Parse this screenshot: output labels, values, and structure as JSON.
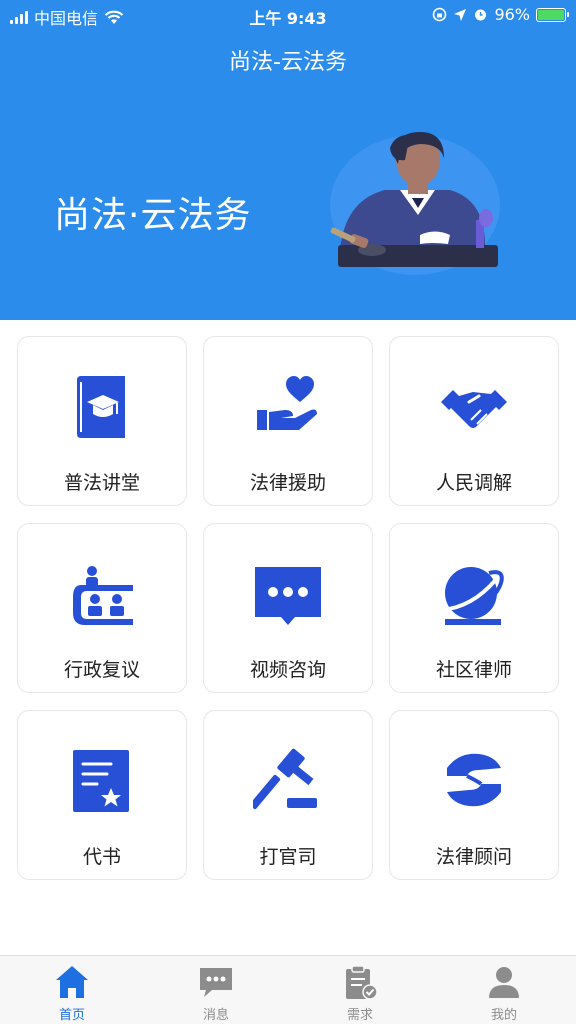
{
  "status_bar": {
    "carrier": "中国电信",
    "time": "上午 9:43",
    "battery": "96%"
  },
  "nav": {
    "title": "尚法-云法务"
  },
  "hero": {
    "text": "尚法·云法务"
  },
  "services": [
    {
      "label": "普法讲堂",
      "icon": "book-icon"
    },
    {
      "label": "法律援助",
      "icon": "heart-hand-icon"
    },
    {
      "label": "人民调解",
      "icon": "handshake-icon"
    },
    {
      "label": "行政复议",
      "icon": "meeting-icon"
    },
    {
      "label": "视频咨询",
      "icon": "chat-bubble-icon"
    },
    {
      "label": "社区律师",
      "icon": "globe-icon"
    },
    {
      "label": "代书",
      "icon": "document-star-icon"
    },
    {
      "label": "打官司",
      "icon": "gavel-icon"
    },
    {
      "label": "法律顾问",
      "icon": "hands-icon"
    }
  ],
  "tabs": [
    {
      "label": "首页",
      "icon": "home-icon",
      "active": true
    },
    {
      "label": "消息",
      "icon": "message-icon",
      "active": false
    },
    {
      "label": "需求",
      "icon": "clipboard-icon",
      "active": false
    },
    {
      "label": "我的",
      "icon": "user-icon",
      "active": false
    }
  ],
  "colors": {
    "header_bg": "#2b8cec",
    "icon_blue": "#2750d6",
    "tab_active": "#1e6fe0",
    "tab_inactive": "#8c8c8c"
  }
}
